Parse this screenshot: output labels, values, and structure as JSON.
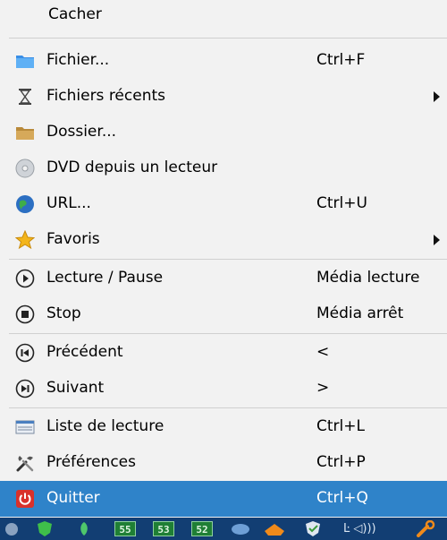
{
  "menu": {
    "header": "Cacher",
    "items": [
      {
        "label": "Fichier...",
        "shortcut": "Ctrl+F",
        "icon": "folder-blue-icon"
      },
      {
        "label": "Fichiers récents",
        "shortcut": "",
        "icon": "hourglass-icon",
        "submenu": true
      },
      {
        "label": "Dossier...",
        "shortcut": "",
        "icon": "folder-icon"
      },
      {
        "label": "DVD depuis un lecteur",
        "shortcut": "",
        "icon": "disc-icon"
      },
      {
        "label": "URL...",
        "shortcut": "Ctrl+U",
        "icon": "globe-icon"
      },
      {
        "label": "Favoris",
        "shortcut": "",
        "icon": "star-icon",
        "submenu": true
      },
      {
        "label": "Lecture / Pause",
        "shortcut": "Média lecture",
        "icon": "play-icon"
      },
      {
        "label": "Stop",
        "shortcut": "Média arrêt",
        "icon": "stop-icon"
      },
      {
        "label": "Précédent",
        "shortcut": "<",
        "icon": "previous-icon"
      },
      {
        "label": "Suivant",
        "shortcut": ">",
        "icon": "next-icon"
      },
      {
        "label": "Liste de lecture",
        "shortcut": "Ctrl+L",
        "icon": "playlist-icon"
      },
      {
        "label": "Préférences",
        "shortcut": "Ctrl+P",
        "icon": "tools-icon"
      },
      {
        "label": "Quitter",
        "shortcut": "Ctrl+Q",
        "icon": "power-icon",
        "selected": true
      }
    ]
  },
  "taskbar": {
    "numbers": [
      "55",
      "53",
      "52"
    ],
    "volume_text": "Ŀ ◁)))"
  },
  "colors": {
    "menu_bg": "#f2f2f2",
    "selected_bg": "#2f83c9",
    "separator": "#d0d0d0",
    "taskbar_bg": "#123e73"
  }
}
